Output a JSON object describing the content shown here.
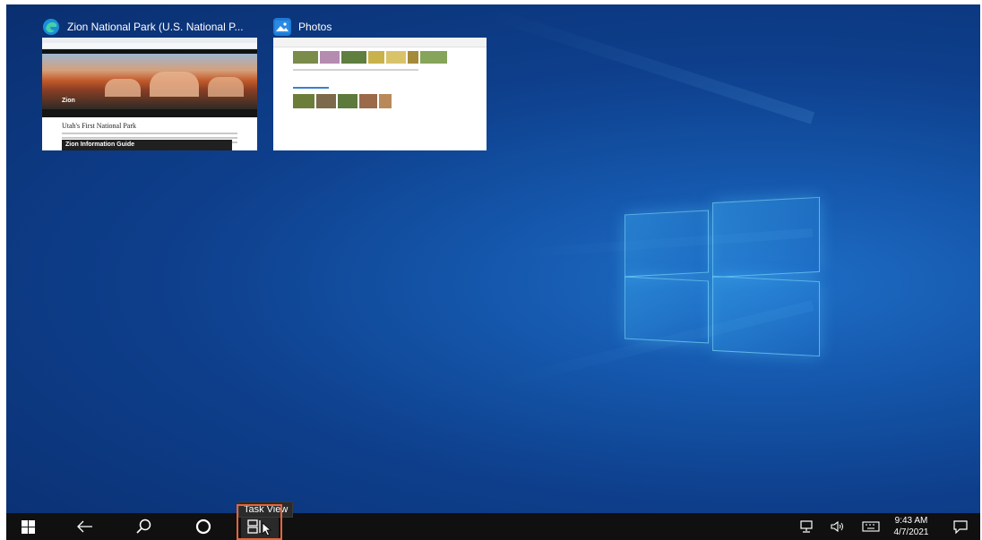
{
  "task_view": {
    "windows": [
      {
        "title": "Zion National Park (U.S. National P...",
        "icon": "edge-browser-icon"
      },
      {
        "title": "Photos",
        "icon": "photos-app-icon"
      }
    ],
    "zion_page": {
      "heading": "Utah's First National Park",
      "banner": "Zion Information Guide",
      "park_name": "Zion"
    }
  },
  "taskbar": {
    "tooltip": "Task View",
    "buttons": [
      "start-button",
      "back-button",
      "search-button",
      "cortana-button",
      "task-view-button"
    ],
    "tray": {
      "time": "9:43 AM",
      "date": "4/7/2021",
      "icons": [
        "network-icon",
        "volume-icon",
        "keyboard-icon",
        "notifications-icon"
      ]
    }
  },
  "colors": {
    "taskbar": "#101010",
    "highlight": "#e8643a",
    "desktop": "#0e3f8c"
  }
}
